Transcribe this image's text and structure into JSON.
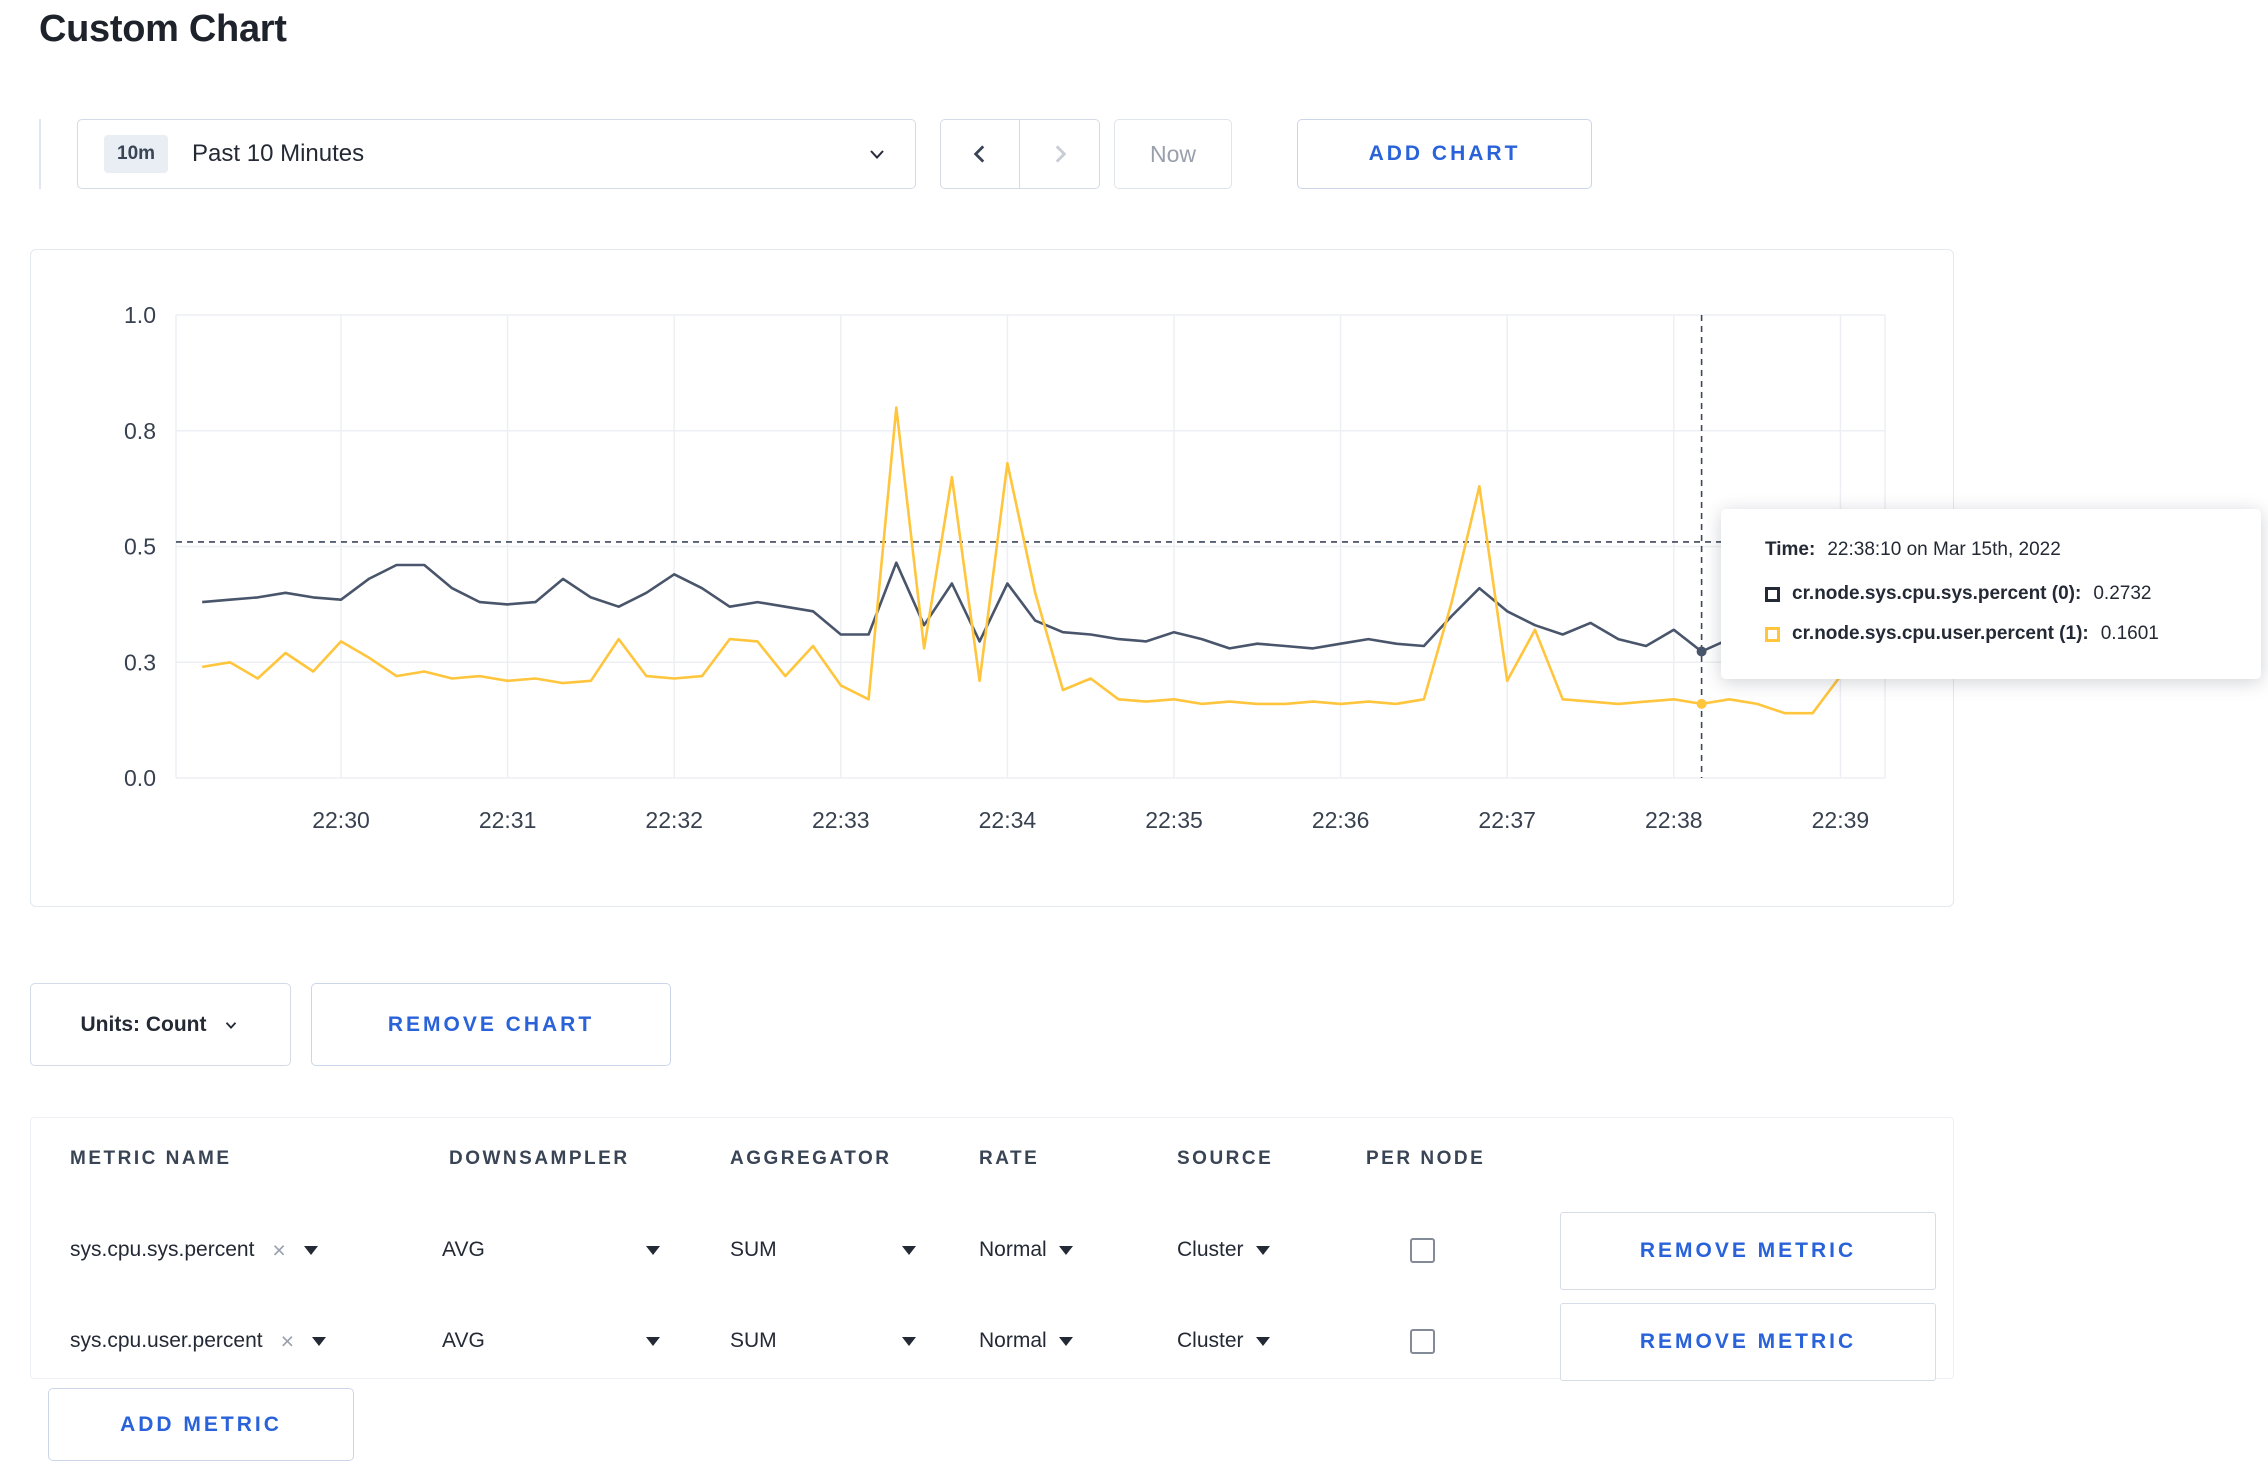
{
  "page": {
    "title": "Custom Chart"
  },
  "toolbar": {
    "time_badge": "10m",
    "time_label": "Past 10 Minutes",
    "now_label": "Now",
    "add_chart_label": "ADD CHART"
  },
  "icons": {
    "clear": "×"
  },
  "colors": {
    "accent": "#2962d9",
    "series_sys": "#49556b",
    "series_user": "#ffc53d"
  },
  "chart_data": {
    "type": "line",
    "ylim": [
      0,
      1
    ],
    "y_ticks": [
      {
        "value": 0,
        "label": "0.0"
      },
      {
        "value": 0.25,
        "label": "0.3"
      },
      {
        "value": 0.5,
        "label": "0.5"
      },
      {
        "value": 0.75,
        "label": "0.8"
      },
      {
        "value": 1,
        "label": "1.0"
      }
    ],
    "x_ticks": [
      "22:30",
      "22:31",
      "22:32",
      "22:33",
      "22:34",
      "22:35",
      "22:36",
      "22:37",
      "22:38",
      "22:39"
    ],
    "crosshair": {
      "t_seconds_from_2230": 490,
      "hline_value": 0.51,
      "dot_values": [
        0.2732,
        0.1601
      ]
    },
    "series": [
      {
        "name": "cr.node.sys.cpu.sys.percent",
        "color": "#49556b",
        "points": [
          [
            -50,
            0.38
          ],
          [
            -40,
            0.385
          ],
          [
            -30,
            0.39
          ],
          [
            -20,
            0.4
          ],
          [
            -10,
            0.39
          ],
          [
            0,
            0.385
          ],
          [
            10,
            0.43
          ],
          [
            20,
            0.46
          ],
          [
            30,
            0.46
          ],
          [
            40,
            0.41
          ],
          [
            50,
            0.38
          ],
          [
            60,
            0.375
          ],
          [
            70,
            0.38
          ],
          [
            80,
            0.43
          ],
          [
            90,
            0.39
          ],
          [
            100,
            0.37
          ],
          [
            110,
            0.4
          ],
          [
            120,
            0.44
          ],
          [
            130,
            0.41
          ],
          [
            140,
            0.37
          ],
          [
            150,
            0.38
          ],
          [
            160,
            0.37
          ],
          [
            170,
            0.36
          ],
          [
            180,
            0.31
          ],
          [
            190,
            0.31
          ],
          [
            200,
            0.465
          ],
          [
            210,
            0.33
          ],
          [
            220,
            0.42
          ],
          [
            230,
            0.295
          ],
          [
            240,
            0.42
          ],
          [
            250,
            0.34
          ],
          [
            260,
            0.315
          ],
          [
            270,
            0.31
          ],
          [
            280,
            0.3
          ],
          [
            290,
            0.295
          ],
          [
            300,
            0.315
          ],
          [
            310,
            0.3
          ],
          [
            320,
            0.28
          ],
          [
            330,
            0.29
          ],
          [
            340,
            0.285
          ],
          [
            350,
            0.28
          ],
          [
            360,
            0.29
          ],
          [
            370,
            0.3
          ],
          [
            380,
            0.29
          ],
          [
            390,
            0.285
          ],
          [
            400,
            0.35
          ],
          [
            410,
            0.41
          ],
          [
            420,
            0.36
          ],
          [
            430,
            0.33
          ],
          [
            440,
            0.31
          ],
          [
            450,
            0.335
          ],
          [
            460,
            0.3
          ],
          [
            470,
            0.285
          ],
          [
            480,
            0.32
          ],
          [
            490,
            0.2732
          ],
          [
            500,
            0.3
          ],
          [
            510,
            0.305
          ],
          [
            520,
            0.3
          ],
          [
            530,
            0.295
          ],
          [
            540,
            0.3
          ],
          [
            550,
            0.305
          ]
        ]
      },
      {
        "name": "cr.node.sys.cpu.user.percent",
        "color": "#ffc53d",
        "points": [
          [
            -50,
            0.24
          ],
          [
            -40,
            0.25
          ],
          [
            -30,
            0.215
          ],
          [
            -20,
            0.27
          ],
          [
            -10,
            0.23
          ],
          [
            0,
            0.295
          ],
          [
            10,
            0.26
          ],
          [
            20,
            0.22
          ],
          [
            30,
            0.23
          ],
          [
            40,
            0.215
          ],
          [
            50,
            0.22
          ],
          [
            60,
            0.21
          ],
          [
            70,
            0.215
          ],
          [
            80,
            0.205
          ],
          [
            90,
            0.21
          ],
          [
            100,
            0.3
          ],
          [
            110,
            0.22
          ],
          [
            120,
            0.215
          ],
          [
            130,
            0.22
          ],
          [
            140,
            0.3
          ],
          [
            150,
            0.295
          ],
          [
            160,
            0.22
          ],
          [
            170,
            0.285
          ],
          [
            180,
            0.2
          ],
          [
            190,
            0.17
          ],
          [
            200,
            0.8
          ],
          [
            210,
            0.28
          ],
          [
            220,
            0.65
          ],
          [
            230,
            0.21
          ],
          [
            240,
            0.68
          ],
          [
            250,
            0.4
          ],
          [
            260,
            0.19
          ],
          [
            270,
            0.215
          ],
          [
            280,
            0.17
          ],
          [
            290,
            0.165
          ],
          [
            300,
            0.17
          ],
          [
            310,
            0.16
          ],
          [
            320,
            0.165
          ],
          [
            330,
            0.16
          ],
          [
            340,
            0.16
          ],
          [
            350,
            0.165
          ],
          [
            360,
            0.16
          ],
          [
            370,
            0.165
          ],
          [
            380,
            0.16
          ],
          [
            390,
            0.17
          ],
          [
            400,
            0.38
          ],
          [
            410,
            0.63
          ],
          [
            420,
            0.21
          ],
          [
            430,
            0.32
          ],
          [
            440,
            0.17
          ],
          [
            450,
            0.165
          ],
          [
            460,
            0.16
          ],
          [
            470,
            0.165
          ],
          [
            480,
            0.17
          ],
          [
            490,
            0.1601
          ],
          [
            500,
            0.17
          ],
          [
            510,
            0.16
          ],
          [
            520,
            0.14
          ],
          [
            530,
            0.14
          ],
          [
            540,
            0.22
          ],
          [
            550,
            0.28
          ]
        ]
      }
    ]
  },
  "tooltip": {
    "time_label": "Time:",
    "time_value": "22:38:10 on Mar 15th, 2022",
    "rows": [
      {
        "name": "cr.node.sys.cpu.sys.percent (0):",
        "value": "0.2732"
      },
      {
        "name": "cr.node.sys.cpu.user.percent (1):",
        "value": "0.1601"
      }
    ]
  },
  "chart_controls": {
    "units_label": "Units: Count",
    "remove_chart_label": "REMOVE CHART"
  },
  "metrics_table": {
    "headers": [
      "METRIC NAME",
      "DOWNSAMPLER",
      "AGGREGATOR",
      "RATE",
      "SOURCE",
      "PER NODE"
    ],
    "rows": [
      {
        "metric": "sys.cpu.sys.percent",
        "downsampler": "AVG",
        "aggregator": "SUM",
        "rate": "Normal",
        "source": "Cluster",
        "remove_label": "REMOVE METRIC"
      },
      {
        "metric": "sys.cpu.user.percent",
        "downsampler": "AVG",
        "aggregator": "SUM",
        "rate": "Normal",
        "source": "Cluster",
        "remove_label": "REMOVE METRIC"
      }
    ],
    "add_metric_label": "ADD METRIC"
  }
}
